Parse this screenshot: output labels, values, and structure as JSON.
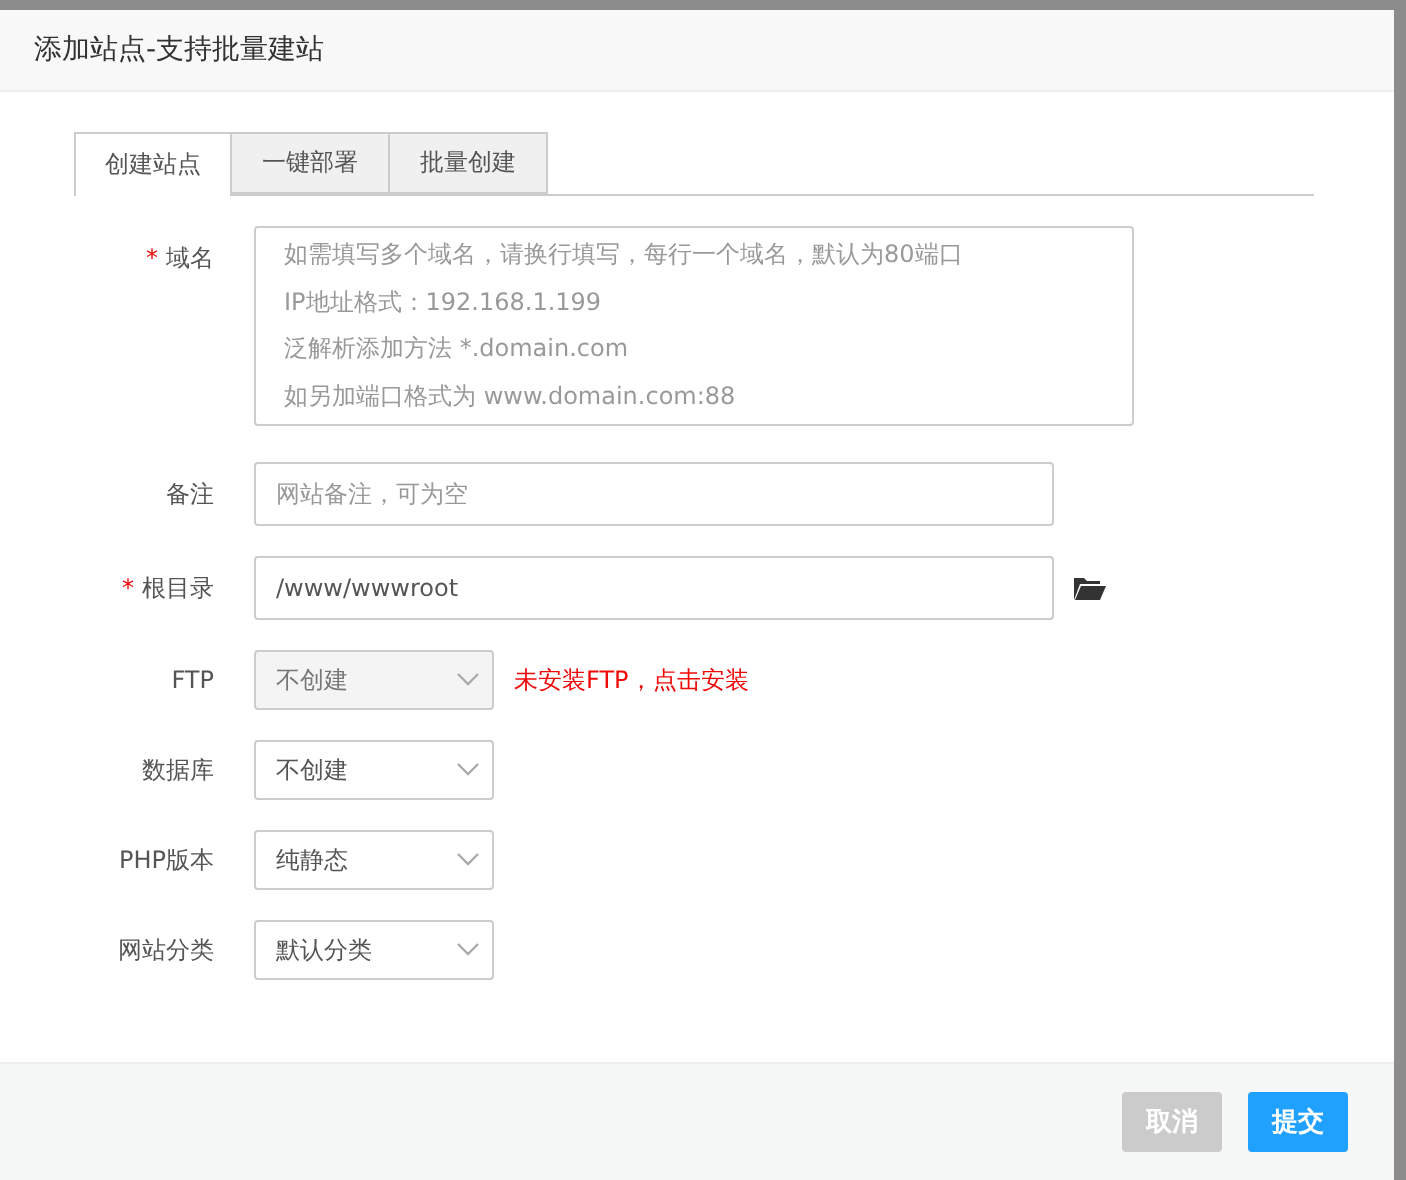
{
  "dialog": {
    "title": "添加站点-支持批量建站"
  },
  "tabs": [
    {
      "label": "创建站点",
      "selected": true
    },
    {
      "label": "一键部署",
      "selected": false
    },
    {
      "label": "批量创建",
      "selected": false
    }
  ],
  "fields": [
    {
      "kind": "textarea",
      "label": "域名",
      "marker": "*",
      "placeholder": "如需填写多个域名，请换行填写，每行一个域名，默认为80端口\nIP地址格式：192.168.1.199\n泛解析添加方法 *.domain.com\n如另加端口格式为 www.domain.com:88"
    },
    {
      "kind": "input",
      "label": "备注",
      "placeholder": "网站备注，可为空"
    },
    {
      "kind": "path",
      "label": "根目录",
      "marker": "*",
      "value": "/www/wwwroot"
    },
    {
      "kind": "select",
      "label": "FTP",
      "value": "不创建",
      "disabled": true,
      "note": "未安装FTP，点击安装"
    },
    {
      "kind": "select",
      "label": "数据库",
      "value": "不创建",
      "disabled": false
    },
    {
      "kind": "select",
      "label": "PHP版本",
      "value": "纯静态",
      "disabled": false
    },
    {
      "kind": "select",
      "label": "网站分类",
      "value": "默认分类",
      "disabled": false
    }
  ],
  "buttons": [
    {
      "label": "取消",
      "kind": "cancel"
    },
    {
      "label": "提交",
      "kind": "primary"
    }
  ]
}
